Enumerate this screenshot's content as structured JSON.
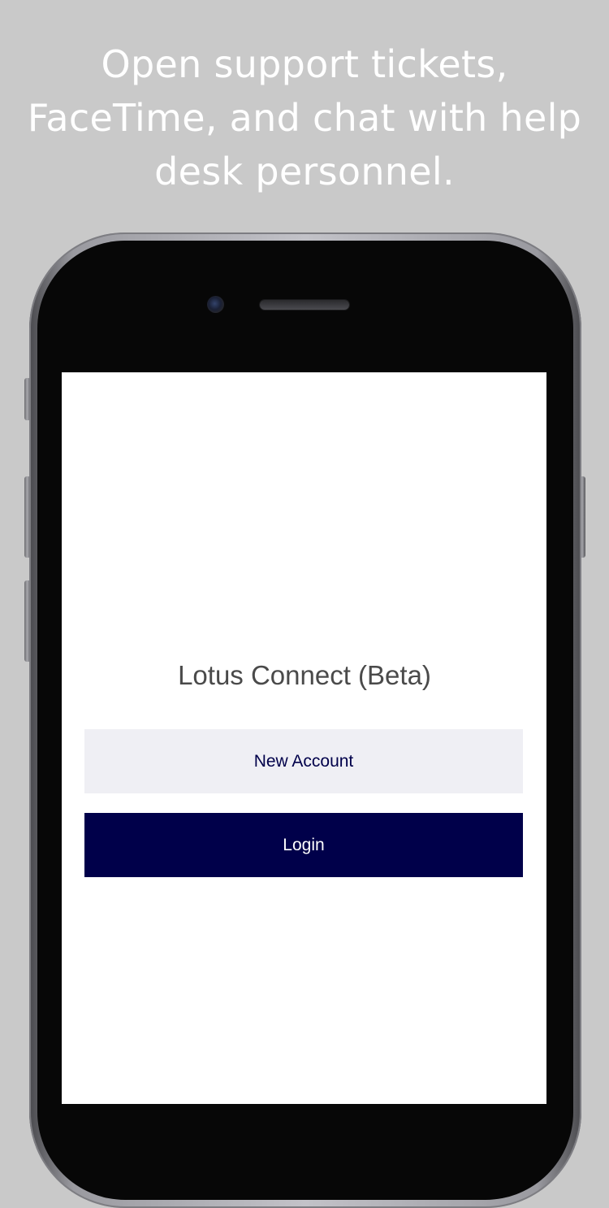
{
  "headline": "Open support tickets, FaceTime, and chat with help desk personnel.",
  "app": {
    "title": "Lotus Connect (Beta)"
  },
  "buttons": {
    "new_account": "New Account",
    "login": "Login"
  },
  "colors": {
    "background": "#c9c9c9",
    "brand_navy": "#00004a",
    "secondary_button": "#efeff4",
    "title_text": "#4a4a4a",
    "headline_text": "#ffffff"
  },
  "icons": {
    "camera": "front-camera-icon",
    "speaker": "earpiece-speaker-icon"
  }
}
